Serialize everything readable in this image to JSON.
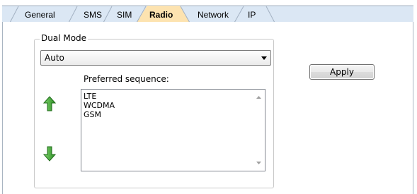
{
  "tabs": [
    {
      "label": "General",
      "active": false
    },
    {
      "label": "SMS",
      "active": false
    },
    {
      "label": "SIM",
      "active": false
    },
    {
      "label": "Radio",
      "active": true
    },
    {
      "label": "Network",
      "active": false
    },
    {
      "label": "IP",
      "active": false
    }
  ],
  "dual_mode": {
    "group_title": "Dual Mode",
    "selected": "Auto",
    "preferred_label": "Preferred sequence:",
    "sequence": [
      "LTE",
      "WCDMA",
      "GSM"
    ]
  },
  "apply_label": "Apply",
  "colors": {
    "active_tab": "#fde3b0",
    "tab_strip": "#dbe7f4",
    "arrow_green": "#2e9a2b"
  },
  "icons": [
    "move-up-arrow-icon",
    "move-down-arrow-icon",
    "dropdown-arrow-icon",
    "scroll-up-icon",
    "scroll-down-icon"
  ]
}
